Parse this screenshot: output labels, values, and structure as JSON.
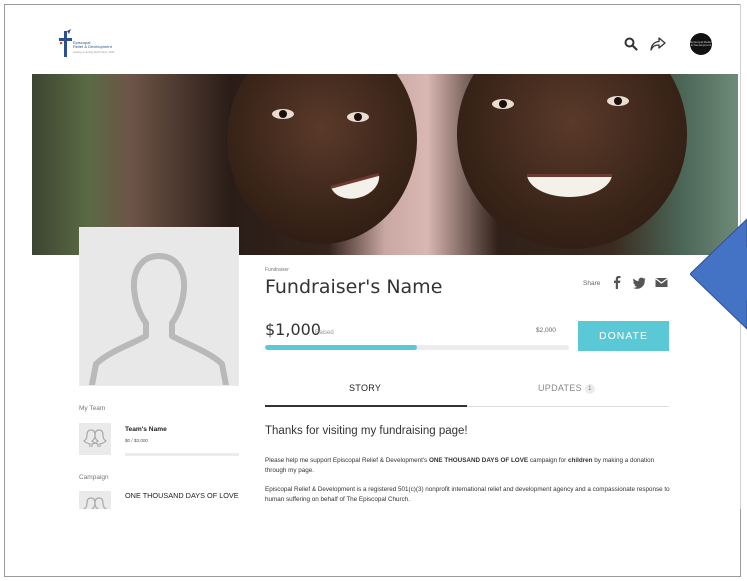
{
  "header": {
    "logo_lines": [
      "Episcopal",
      "Relief & Development"
    ],
    "logo_tagline": "Healing a Hurting World Since 1940",
    "avatar_text": "Episcopal Relief & Development"
  },
  "fundraiser": {
    "label": "Fundraiser",
    "name": "Fundraiser's Name",
    "share_label": "Share",
    "raised": "$1,000",
    "raised_word": "Raised",
    "goal": "$2,000",
    "progress_percent": 50,
    "donate_label": "DONATE"
  },
  "tabs": [
    {
      "label": "STORY",
      "active": true
    },
    {
      "label": "UPDATES",
      "badge": "1",
      "active": false
    }
  ],
  "story": {
    "title": "Thanks for visiting my fundraising page!",
    "p1_a": "Please help me support Episcopal Relief & Development's ",
    "p1_b": "ONE THOUSAND DAYS OF LOVE",
    "p1_c": " campaign for ",
    "p1_d": "children",
    "p1_e": " by making a donation through my page.",
    "p2": "Episcopal Relief & Development is a registered 501(c)(3) nonprofit international relief and development agency and a compassionate response to human suffering on behalf of The Episcopal Church."
  },
  "sidebar": {
    "team_label": "My Team",
    "team_name": "Team's Name",
    "team_progress": "$0 / $3,000",
    "campaign_label": "Campaign",
    "campaign_name": "ONE THOUSAND DAYS OF LOVE"
  },
  "colors": {
    "accent": "#5bc8d6",
    "callout_arrow": "#4472c4",
    "logo_blue": "#2b4f8f"
  }
}
